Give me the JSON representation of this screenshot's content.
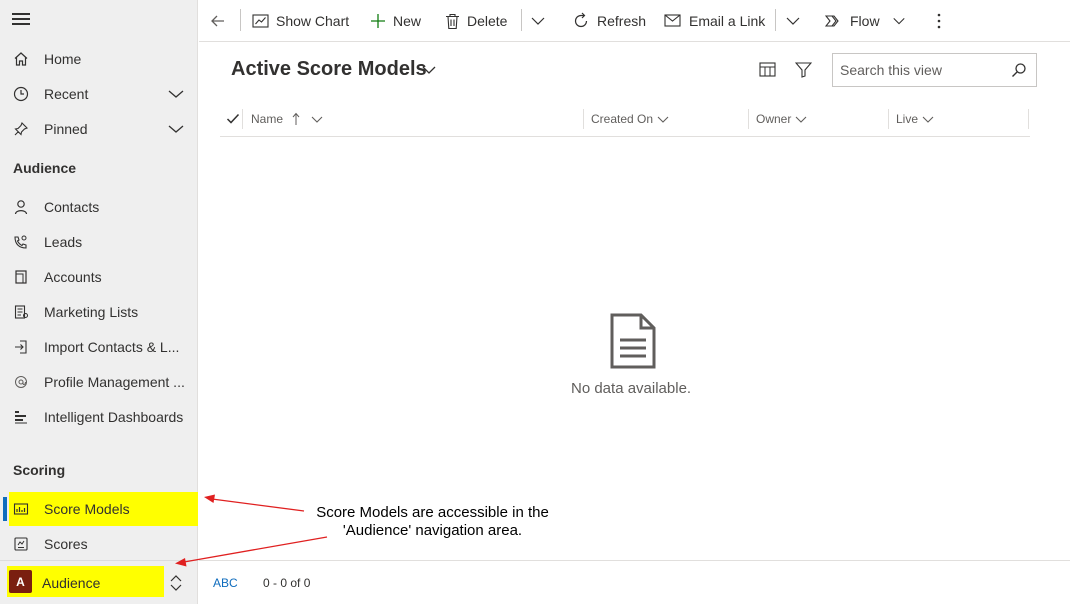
{
  "sidebar": {
    "top_items": [
      {
        "label": "Home",
        "icon": "home-icon"
      },
      {
        "label": "Recent",
        "icon": "clock-icon"
      },
      {
        "label": "Pinned",
        "icon": "pin-icon"
      }
    ],
    "audience_header": "Audience",
    "audience_items": [
      {
        "label": "Contacts",
        "icon": "person-icon"
      },
      {
        "label": "Leads",
        "icon": "phone-person-icon"
      },
      {
        "label": "Accounts",
        "icon": "building-icon"
      },
      {
        "label": "Marketing Lists",
        "icon": "list-icon"
      },
      {
        "label": "Import Contacts & L...",
        "icon": "import-icon"
      },
      {
        "label": "Profile Management ...",
        "icon": "at-icon"
      },
      {
        "label": "Intelligent Dashboards",
        "icon": "dashboard-icon"
      }
    ],
    "scoring_header": "Scoring",
    "scoring_items": [
      {
        "label": "Score Models",
        "icon": "score-model-icon",
        "selected": true
      },
      {
        "label": "Scores",
        "icon": "scores-icon"
      }
    ],
    "area_switcher": {
      "badge": "A",
      "label": "Audience"
    }
  },
  "commandbar": {
    "show_chart": "Show Chart",
    "new": "New",
    "delete": "Delete",
    "refresh": "Refresh",
    "email_link": "Email a Link",
    "flow": "Flow"
  },
  "view": {
    "title": "Active Score Models",
    "search_placeholder": "Search this view",
    "columns": [
      "Name",
      "Created On",
      "Owner",
      "Live"
    ],
    "empty_message": "No data available."
  },
  "footer": {
    "abc": "ABC",
    "record_count": "0 - 0 of 0"
  },
  "annotation": {
    "text": "Score Models are accessible in the 'Audience' navigation area."
  },
  "colors": {
    "highlight": "#ffff00",
    "accent": "#0f6cbd",
    "arrow": "#e02020",
    "area_badge": "#7a1f10"
  }
}
